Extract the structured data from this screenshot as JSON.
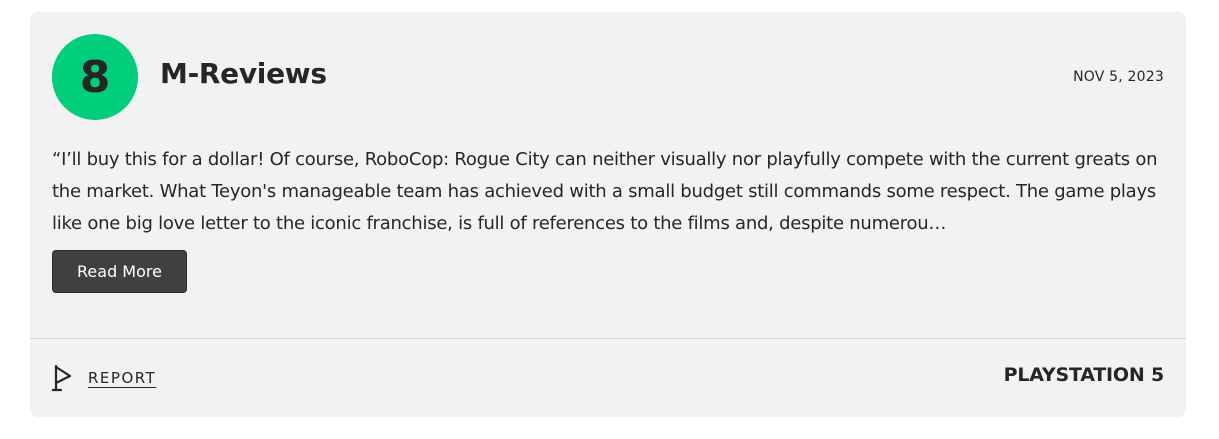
{
  "review": {
    "score": "8",
    "score_color": "#00ce7a",
    "publication": "M-Reviews",
    "date": "NOV 5, 2023",
    "quote": "“I’ll buy this for a dollar! Of course, RoboCop: Rogue City can neither visually nor playfully compete with the current greats on the market. What Teyon's manageable team has achieved with a small budget still commands some respect. The game plays like one big love letter to the iconic franchise, is full of references to the films and, despite numerou…",
    "read_more_label": "Read More",
    "report_label": "REPORT",
    "report_icon": "flag-icon",
    "platform": "PLAYSTATION 5"
  }
}
